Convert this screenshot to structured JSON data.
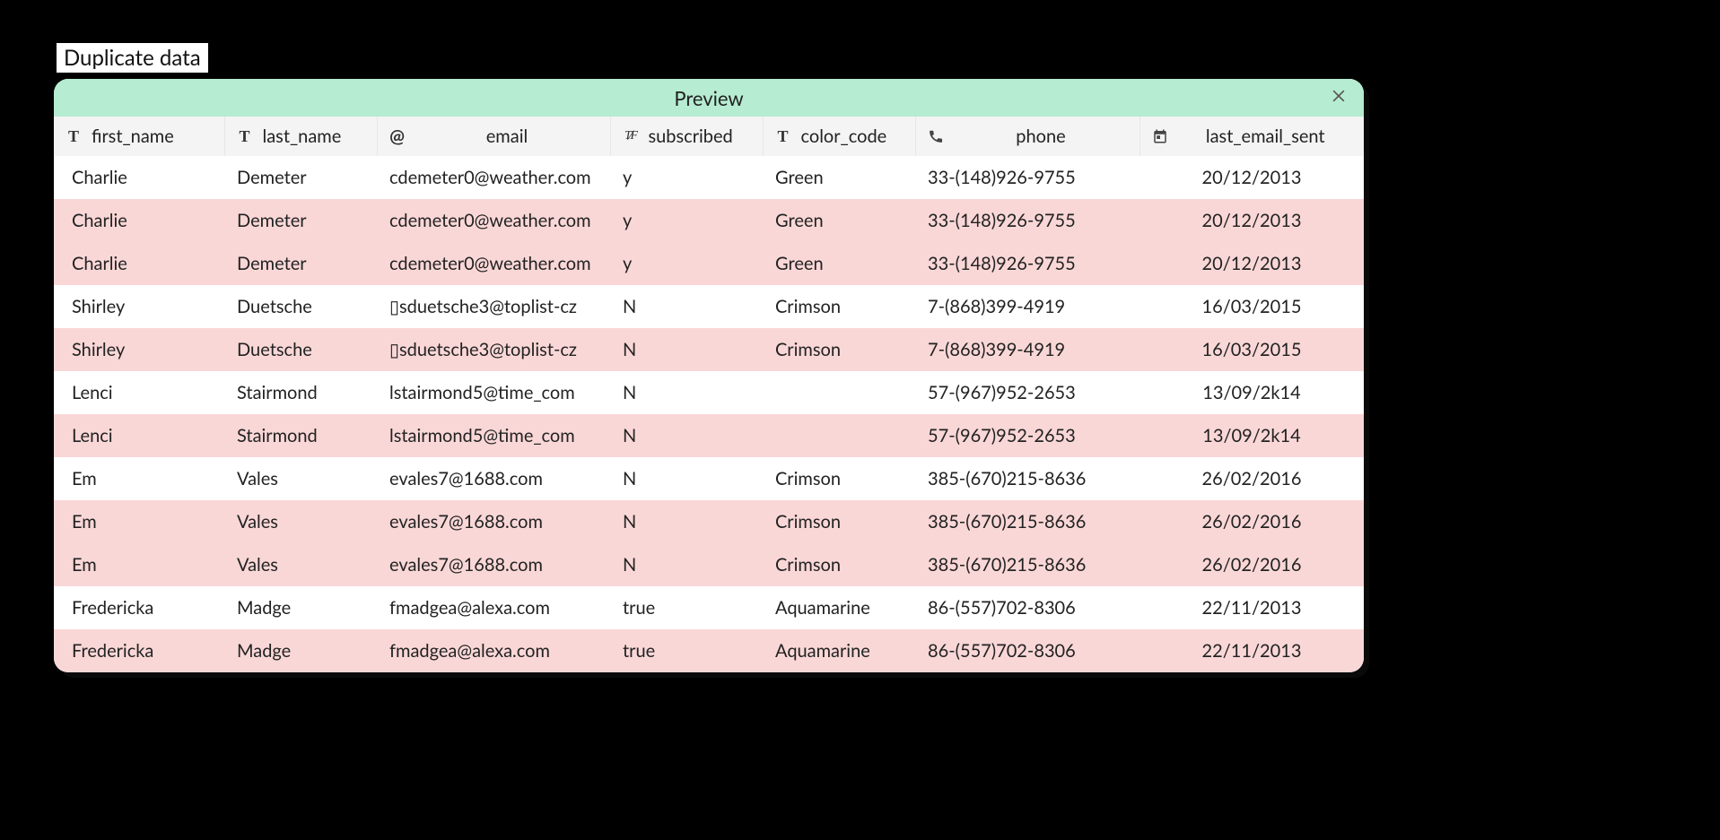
{
  "title": "Duplicate data",
  "panel": {
    "header": "Preview",
    "close_label": "Close"
  },
  "columns": [
    {
      "key": "first_name",
      "label": "first_name",
      "type": "text"
    },
    {
      "key": "last_name",
      "label": "last_name",
      "type": "text"
    },
    {
      "key": "email",
      "label": "email",
      "type": "email"
    },
    {
      "key": "subscribed",
      "label": "subscribed",
      "type": "bool"
    },
    {
      "key": "color_code",
      "label": "color_code",
      "type": "text"
    },
    {
      "key": "phone",
      "label": "phone",
      "type": "phone"
    },
    {
      "key": "last_email_sent",
      "label": "last_email_sent",
      "type": "date"
    }
  ],
  "rows": [
    {
      "dup": false,
      "first_name": "Charlie",
      "last_name": "Demeter",
      "email": "cdemeter0@weather.com",
      "subscribed": "y",
      "color_code": "Green",
      "phone": "33-(148)926-9755",
      "last_email_sent": "20/12/2013"
    },
    {
      "dup": true,
      "first_name": "Charlie",
      "last_name": "Demeter",
      "email": "cdemeter0@weather.com",
      "subscribed": "y",
      "color_code": "Green",
      "phone": "33-(148)926-9755",
      "last_email_sent": "20/12/2013"
    },
    {
      "dup": true,
      "first_name": "Charlie",
      "last_name": "Demeter",
      "email": "cdemeter0@weather.com",
      "subscribed": "y",
      "color_code": "Green",
      "phone": "33-(148)926-9755",
      "last_email_sent": "20/12/2013"
    },
    {
      "dup": false,
      "first_name": "Shirley",
      "last_name": "Duetsche",
      "email": "▯sduetsche3@toplist-cz",
      "subscribed": "N",
      "color_code": "Crimson",
      "phone": "7-(868)399-4919",
      "last_email_sent": "16/03/2015"
    },
    {
      "dup": true,
      "first_name": "Shirley",
      "last_name": "Duetsche",
      "email": "▯sduetsche3@toplist-cz",
      "subscribed": "N",
      "color_code": "Crimson",
      "phone": "7-(868)399-4919",
      "last_email_sent": "16/03/2015"
    },
    {
      "dup": false,
      "first_name": "Lenci",
      "last_name": "Stairmond",
      "email": "lstairmond5@time_com",
      "subscribed": "N",
      "color_code": "",
      "phone": "57-(967)952-2653",
      "last_email_sent": "13/09/2k14"
    },
    {
      "dup": true,
      "first_name": "Lenci",
      "last_name": "Stairmond",
      "email": "lstairmond5@time_com",
      "subscribed": "N",
      "color_code": "",
      "phone": "57-(967)952-2653",
      "last_email_sent": "13/09/2k14"
    },
    {
      "dup": false,
      "first_name": "Em",
      "last_name": "Vales",
      "email": "evales7@1688.com",
      "subscribed": "N",
      "color_code": "Crimson",
      "phone": "385-(670)215-8636",
      "last_email_sent": "26/02/2016"
    },
    {
      "dup": true,
      "first_name": "Em",
      "last_name": "Vales",
      "email": "evales7@1688.com",
      "subscribed": "N",
      "color_code": "Crimson",
      "phone": "385-(670)215-8636",
      "last_email_sent": "26/02/2016"
    },
    {
      "dup": true,
      "first_name": "Em",
      "last_name": "Vales",
      "email": "evales7@1688.com",
      "subscribed": "N",
      "color_code": "Crimson",
      "phone": "385-(670)215-8636",
      "last_email_sent": "26/02/2016"
    },
    {
      "dup": false,
      "first_name": "Fredericka",
      "last_name": "Madge",
      "email": "fmadgea@alexa.com",
      "subscribed": "true",
      "color_code": "Aquamarine",
      "phone": "86-(557)702-8306",
      "last_email_sent": "22/11/2013"
    },
    {
      "dup": true,
      "first_name": "Fredericka",
      "last_name": "Madge",
      "email": "fmadgea@alexa.com",
      "subscribed": "true",
      "color_code": "Aquamarine",
      "phone": "86-(557)702-8306",
      "last_email_sent": "22/11/2013"
    }
  ]
}
